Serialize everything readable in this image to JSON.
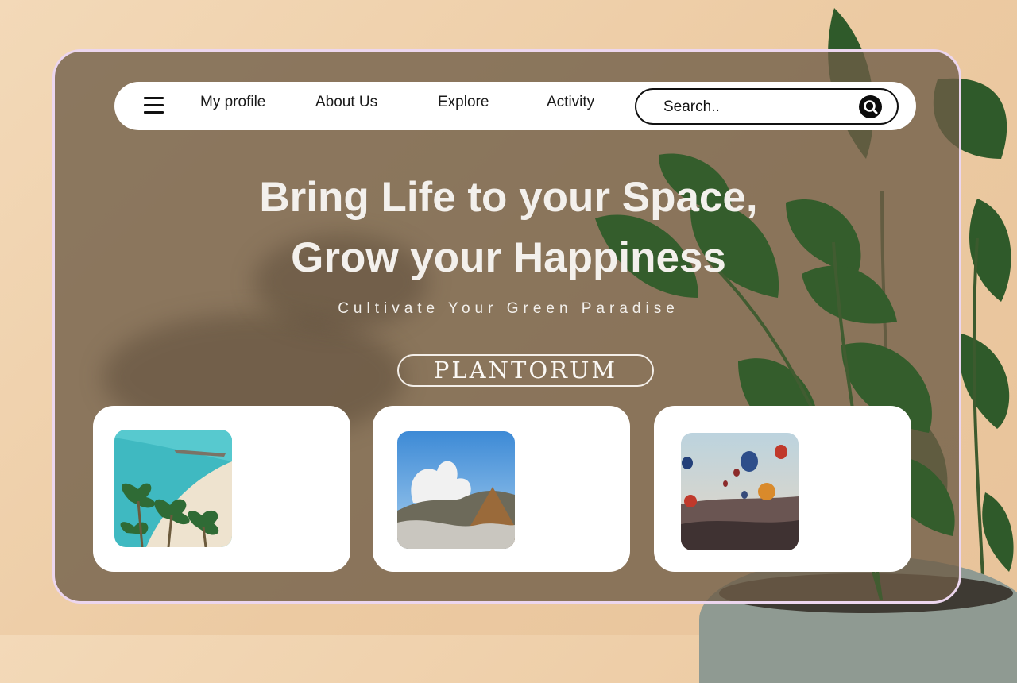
{
  "nav": {
    "menu_icon": "hamburger-menu-icon",
    "links": [
      "My profile",
      "About Us",
      "Explore",
      "Activity"
    ]
  },
  "search": {
    "placeholder": "Search..",
    "icon": "search-icon"
  },
  "hero": {
    "title_line1": "Bring Life to your Space,",
    "title_line2": "Grow your Happiness",
    "subtitle": "Cultivate Your Green Paradise",
    "brand": "PLANTORUM"
  },
  "cards": [
    {
      "image": "tropical-beach-palm-trees-photo"
    },
    {
      "image": "volcano-smoke-landscape-photo"
    },
    {
      "image": "hot-air-balloons-valley-photo"
    }
  ],
  "colors": {
    "frame_border": "#ecd6ee",
    "overlay": "#6e5c46",
    "text_light": "#f3f0ec",
    "accent_dark": "#0c0c0c"
  }
}
